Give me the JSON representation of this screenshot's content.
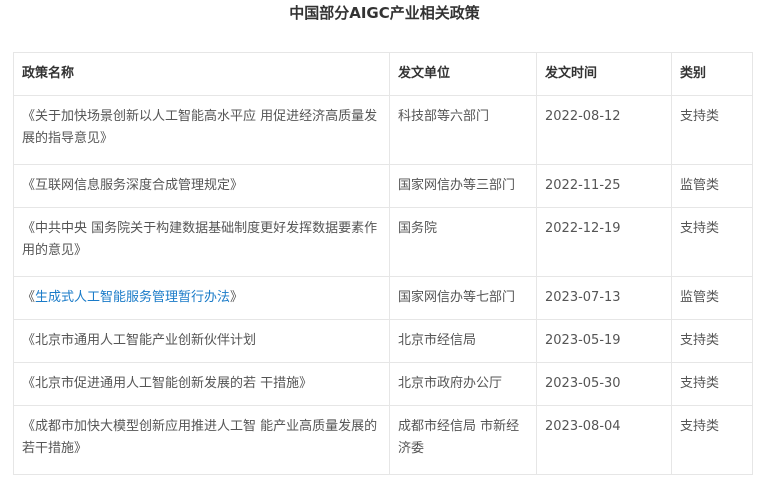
{
  "title": "中国部分AIGC产业相关政策",
  "table": {
    "headers": [
      "政策名称",
      "发文单位",
      "发文时间",
      "类别"
    ],
    "rows": [
      {
        "name": "《关于加快场景创新以人工智能高水平应 用促进经济高质量发展的指导意见》",
        "issuer": "科技部等六部门",
        "date": "2022-08-12",
        "category": "支持类",
        "is_link": false
      },
      {
        "name": "《互联网信息服务深度合成管理规定》",
        "issuer": "国家网信办等三部门",
        "date": "2022-11-25",
        "category": "监管类",
        "is_link": false
      },
      {
        "name": "《中共中央 国务院关于构建数据基础制度更好发挥数据要素作用的意见》",
        "issuer": "国务院",
        "date": "2022-12-19",
        "category": "支持类",
        "is_link": false
      },
      {
        "name_prefix": "《",
        "name_link": "生成式人工智能服务管理暂行办法",
        "name_suffix": "》",
        "issuer": "国家网信办等七部门",
        "date": "2023-07-13",
        "category": "监管类",
        "is_link": true
      },
      {
        "name": "《北京市通用人工智能产业创新伙伴计划",
        "issuer": "北京市经信局",
        "date": "2023-05-19",
        "category": "支持类",
        "is_link": false
      },
      {
        "name": "《北京市促进通用人工智能创新发展的若 干措施》",
        "issuer": "北京市政府办公厅",
        "date": "2023-05-30",
        "category": "支持类",
        "is_link": false
      },
      {
        "name": "《成都市加快大模型创新应用推进人工智 能产业高质量发展的若干措施》",
        "issuer": "成都市经信局 市新经济委",
        "date": "2023-08-04",
        "category": "支持类",
        "is_link": false
      }
    ]
  },
  "colors": {
    "link": "#1a7bc8",
    "border": "#e6e6e6",
    "text": "#555555",
    "heading": "#333333"
  }
}
